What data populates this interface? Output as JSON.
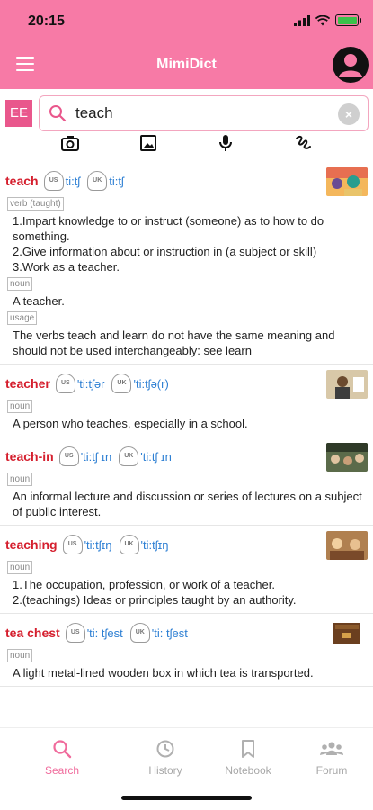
{
  "status_bar": {
    "time": "20:15"
  },
  "header": {
    "title": "MimiDict"
  },
  "search": {
    "lang_badge": "EE",
    "value": "teach",
    "clear_label": "×"
  },
  "toolbar": {
    "icons": [
      "camera-icon",
      "image-icon",
      "microphone-icon",
      "handwriting-icon"
    ]
  },
  "entries": [
    {
      "word": "teach",
      "prons": [
        {
          "region": "US",
          "ipa": "ti:tʃ"
        },
        {
          "region": "UK",
          "ipa": "ti:tʃ"
        }
      ],
      "senses": [
        {
          "pos": "verb (taught)",
          "lines": [
            "1.Impart knowledge to or instruct (someone) as to how to do something.",
            "2.Give information about or instruction in (a subject or skill)",
            "3.Work as a teacher."
          ]
        },
        {
          "pos": "noun",
          "lines": [
            "A teacher."
          ]
        },
        {
          "pos": "usage",
          "lines": [
            "The verbs teach and learn do not have the same meaning and should not be used interchangeably: see learn"
          ]
        }
      ]
    },
    {
      "word": "teacher",
      "prons": [
        {
          "region": "US",
          "ipa": "'ti:tʃər"
        },
        {
          "region": "UK",
          "ipa": "'ti:tʃə(r)"
        }
      ],
      "senses": [
        {
          "pos": "noun",
          "lines": [
            "A person who teaches, especially in a school."
          ]
        }
      ]
    },
    {
      "word": "teach-in",
      "prons": [
        {
          "region": "US",
          "ipa": "'ti:tʃ ɪn"
        },
        {
          "region": "UK",
          "ipa": "'ti:tʃ ɪn"
        }
      ],
      "senses": [
        {
          "pos": "noun",
          "lines": [
            "An informal lecture and discussion or series of lectures on a subject of public interest."
          ]
        }
      ]
    },
    {
      "word": "teaching",
      "prons": [
        {
          "region": "US",
          "ipa": "'ti:tʃɪŋ"
        },
        {
          "region": "UK",
          "ipa": "'ti:tʃɪŋ"
        }
      ],
      "senses": [
        {
          "pos": "noun",
          "lines": [
            "1.The occupation, profession, or work of a teacher.",
            "2.(teachings) Ideas or principles taught by an authority."
          ]
        }
      ]
    },
    {
      "word": "tea chest",
      "prons": [
        {
          "region": "US",
          "ipa": "'ti: tʃest"
        },
        {
          "region": "UK",
          "ipa": "'ti: tʃest"
        }
      ],
      "senses": [
        {
          "pos": "noun",
          "lines": [
            "A light metal-lined wooden box in which tea is transported."
          ]
        }
      ]
    }
  ],
  "tabs": [
    {
      "label": "Search",
      "icon": "search-icon",
      "active": true
    },
    {
      "label": "History",
      "icon": "clock-icon",
      "active": false
    },
    {
      "label": "Notebook",
      "icon": "bookmark-icon",
      "active": false
    },
    {
      "label": "Forum",
      "icon": "people-icon",
      "active": false
    }
  ],
  "colors": {
    "accent": "#f77aa6",
    "headword": "#d51f2e",
    "ipa": "#2d7fd3",
    "badge": "#e9578c"
  }
}
